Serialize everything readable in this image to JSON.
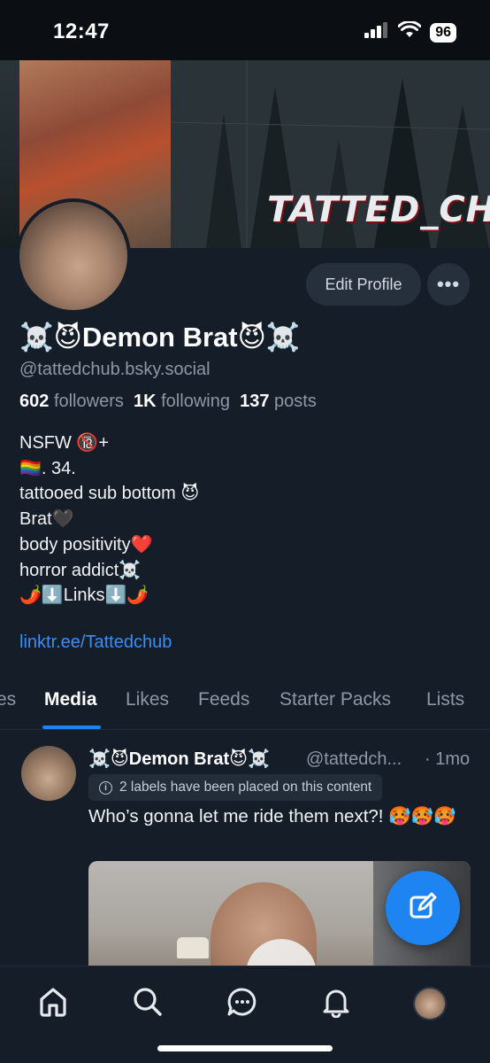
{
  "status_bar": {
    "time": "12:47",
    "battery": "96",
    "icons": [
      "cellular-signal-icon",
      "wifi-icon",
      "battery-icon"
    ]
  },
  "banner": {
    "text": "TATTED_CHUB"
  },
  "profile": {
    "display_name": "☠️😈Demon Brat😈☠️",
    "handle": "@tattedchub.bsky.social",
    "followers_count": "602",
    "followers_label": "followers",
    "following_count": "1K",
    "following_label": "following",
    "posts_count": "137",
    "posts_label": "posts",
    "edit_profile_label": "Edit Profile",
    "more_label": "•••",
    "bio_lines": [
      "NSFW 🔞+",
      "🏳️‍🌈. 34.",
      "tattooed sub bottom 😈",
      "Brat🖤",
      "body positivity❤️",
      "horror addict☠️",
      "🌶️⬇️Links⬇️🌶️"
    ],
    "link": "linktr.ee/Tattedchub"
  },
  "tabs": [
    {
      "label": "es",
      "active": false
    },
    {
      "label": "Media",
      "active": true
    },
    {
      "label": "Likes",
      "active": false
    },
    {
      "label": "Feeds",
      "active": false
    },
    {
      "label": "Starter Packs",
      "active": false
    },
    {
      "label": "Lists",
      "active": false
    }
  ],
  "post": {
    "author": "☠️😈Demon Brat😈☠️",
    "handle": "@tattedch...",
    "time": "· 1mo",
    "labels_notice": "2 labels have been placed on this content",
    "text": "Who’s gonna let me ride them next?! 🥵🥵🥵"
  },
  "colors": {
    "background": "#151d28",
    "accent": "#1d84f2",
    "link": "#3a8ef5",
    "muted_text": "#8c98a6"
  },
  "bottom_nav": [
    "home-icon",
    "search-icon",
    "chat-icon",
    "bell-icon",
    "profile-avatar"
  ]
}
